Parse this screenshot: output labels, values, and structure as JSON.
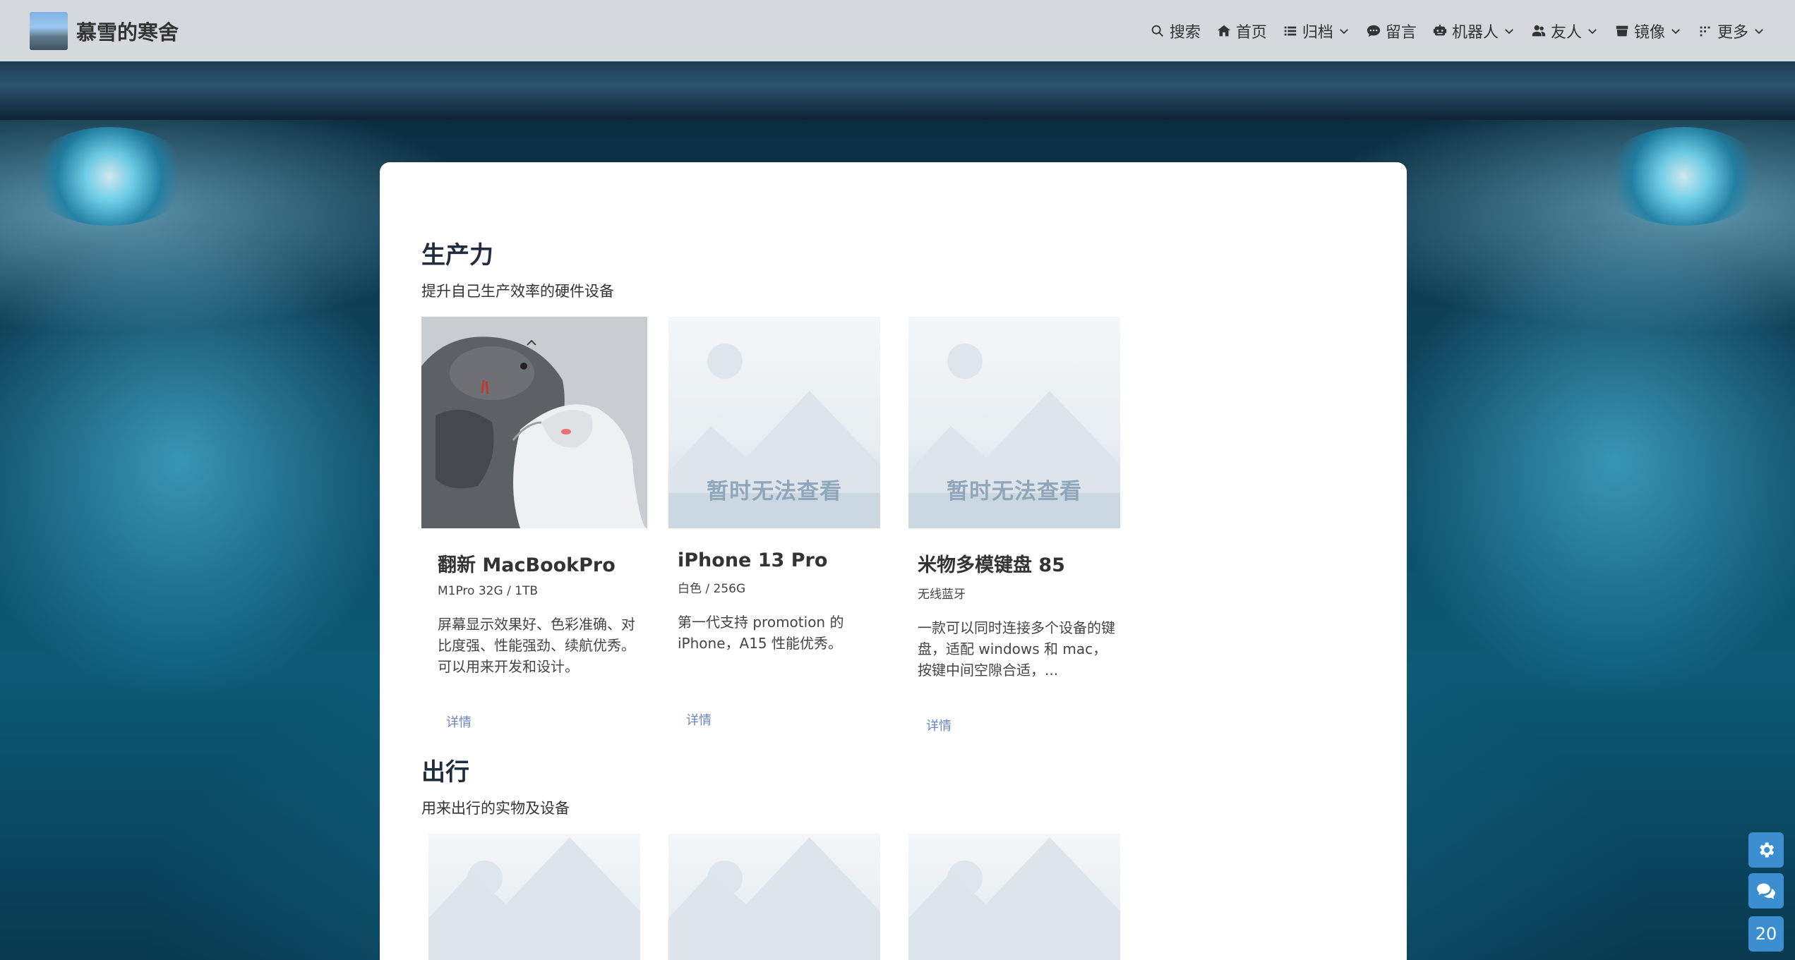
{
  "site": {
    "title": "慕雪的寒舍"
  },
  "nav": {
    "items": [
      {
        "label": "搜索",
        "icon": "search-icon",
        "dropdown": false
      },
      {
        "label": "首页",
        "icon": "home-icon",
        "dropdown": false
      },
      {
        "label": "归档",
        "icon": "list-icon",
        "dropdown": true
      },
      {
        "label": "留言",
        "icon": "comment-icon",
        "dropdown": false
      },
      {
        "label": "机器人",
        "icon": "robot-icon",
        "dropdown": true
      },
      {
        "label": "友人",
        "icon": "users-icon",
        "dropdown": true
      },
      {
        "label": "镜像",
        "icon": "mirror-icon",
        "dropdown": true
      },
      {
        "label": "更多",
        "icon": "more-icon",
        "dropdown": true
      }
    ]
  },
  "sections": [
    {
      "title": "生产力",
      "desc": "提升自己生产效率的硬件设备",
      "cards": [
        {
          "title": "翻新 MacBookPro",
          "sub": "M1Pro 32G / 1TB",
          "desc": "屏幕显示效果好、色彩准确、对比度强、性能强劲、续航优秀。可以用来开发和设计。",
          "link": "详情",
          "image": "photo"
        },
        {
          "title": "iPhone 13 Pro",
          "sub": "白色 / 256G",
          "desc": "第一代支持 promotion 的 iPhone，A15 性能优秀。",
          "link": "详情",
          "image": "placeholder",
          "placeholder_text": "暂时无法查看"
        },
        {
          "title": "米物多模键盘 85",
          "sub": "无线蓝牙",
          "desc": "一款可以同时连接多个设备的键盘，适配 windows 和 mac，按键中间空隙合适，...",
          "link": "详情",
          "image": "placeholder",
          "placeholder_text": "暂时无法查看"
        }
      ]
    },
    {
      "title": "出行",
      "desc": "用来出行的实物及设备"
    }
  ],
  "floating": {
    "counter": "20"
  },
  "colors": {
    "accent": "#3b8ed0",
    "link": "#6a85c2"
  }
}
